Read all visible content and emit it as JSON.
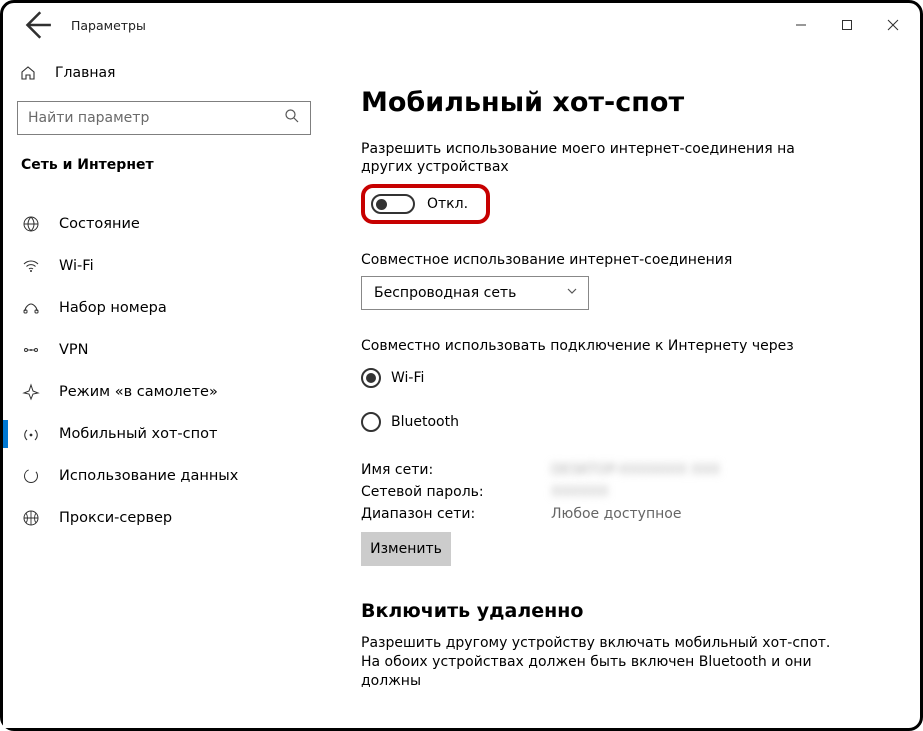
{
  "titlebar": {
    "app_title": "Параметры"
  },
  "sidebar": {
    "home_label": "Главная",
    "search_placeholder": "Найти параметр",
    "section_title": "Сеть и Интернет",
    "items": [
      {
        "id": "status",
        "label": "Состояние"
      },
      {
        "id": "wifi",
        "label": "Wi-Fi"
      },
      {
        "id": "dialup",
        "label": "Набор номера"
      },
      {
        "id": "vpn",
        "label": "VPN"
      },
      {
        "id": "airplane",
        "label": "Режим «в самолете»"
      },
      {
        "id": "hotspot",
        "label": "Мобильный хот-спот"
      },
      {
        "id": "data",
        "label": "Использование данных"
      },
      {
        "id": "proxy",
        "label": "Прокси-сервер"
      }
    ]
  },
  "main": {
    "heading": "Мобильный хот-спот",
    "share_label": "Разрешить использование моего интернет-соединения на других устройствах",
    "toggle_state": "Откл.",
    "share_conn_label": "Совместное использование интернет-соединения",
    "share_conn_value": "Беспроводная сеть",
    "share_via_label": "Совместно использовать подключение к Интернету через",
    "radio_wifi": "Wi-Fi",
    "radio_bt": "Bluetooth",
    "net_name_label": "Имя сети:",
    "net_name_value": "DESKTOP-XXXXXXX XXX",
    "net_pass_label": "Сетевой пароль:",
    "net_pass_value": "XXXXXX",
    "net_band_label": "Диапазон сети:",
    "net_band_value": "Любое доступное",
    "edit_btn": "Изменить",
    "remote_heading": "Включить удаленно",
    "remote_desc": "Разрешить другому устройству включать мобильный хот-спот. На обоих устройствах должен быть включен Bluetooth и они должны"
  }
}
